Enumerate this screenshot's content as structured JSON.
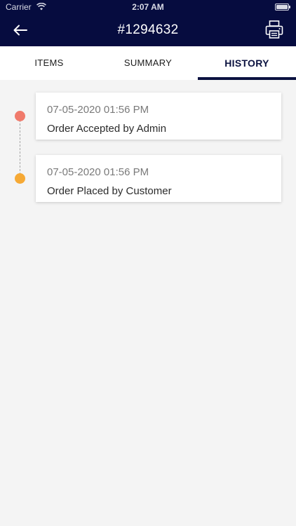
{
  "status_bar": {
    "carrier": "Carrier",
    "time": "2:07 AM"
  },
  "header": {
    "title": "#1294632",
    "back_icon": "arrow-left-icon",
    "print_icon": "printer-icon",
    "background_color": "#060c3f"
  },
  "tabs": [
    {
      "label": "ITEMS",
      "active": false
    },
    {
      "label": "SUMMARY",
      "active": false
    },
    {
      "label": "HISTORY",
      "active": true
    }
  ],
  "history": [
    {
      "timestamp": "07-05-2020 01:56 PM",
      "event": "Order Accepted by Admin",
      "dot_color": "#f07a6b"
    },
    {
      "timestamp": "07-05-2020 01:56 PM",
      "event": "Order Placed by Customer",
      "dot_color": "#f6a935"
    }
  ]
}
